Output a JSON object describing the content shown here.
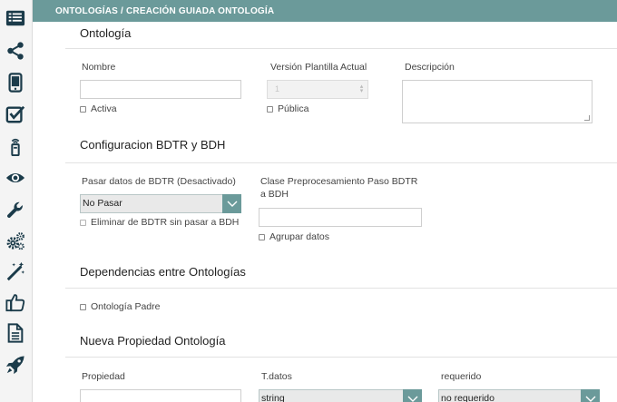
{
  "header": {
    "breadcrumb": "ONTOLOGÍAS / CREACIÓN GUIADA ONTOLOGÍA"
  },
  "sidebar": {
    "icons": [
      "list-icon",
      "share-icon",
      "mobile-icon",
      "checklist-icon",
      "sensor-icon",
      "eye-icon",
      "wrench-icon",
      "gears-icon",
      "magic-wand-icon",
      "thumbs-up-icon",
      "document-icon",
      "rocket-icon"
    ]
  },
  "ontologia": {
    "title": "Ontología",
    "nombre_label": "Nombre",
    "nombre_value": "",
    "version_label": "Versión Plantilla Actual",
    "version_value": "1",
    "descripcion_label": "Descripción",
    "descripcion_value": "",
    "activa_label": "Activa",
    "publica_label": "Pública"
  },
  "bdtr": {
    "title": "Configuracion BDTR y BDH",
    "pasar_label": "Pasar datos de BDTR (Desactivado)",
    "pasar_value": "No Pasar",
    "eliminar_label": "Eliminar de BDTR sin pasar a BDH",
    "clase_label": "Clase Preprocesamiento Paso BDTR a BDH",
    "clase_value": "",
    "agrupar_label": "Agrupar datos"
  },
  "dependencias": {
    "title": "Dependencias entre Ontologías",
    "padre_label": "Ontología Padre"
  },
  "propiedad": {
    "title": "Nueva Propiedad Ontología",
    "propiedad_label": "Propiedad",
    "propiedad_value": "",
    "tdatos_label": "T.datos",
    "tdatos_value": "string",
    "requerido_label": "requerido",
    "requerido_value": "no requerido"
  },
  "colors": {
    "accent": "#6b9a9a",
    "icon": "#1b3b4a"
  }
}
